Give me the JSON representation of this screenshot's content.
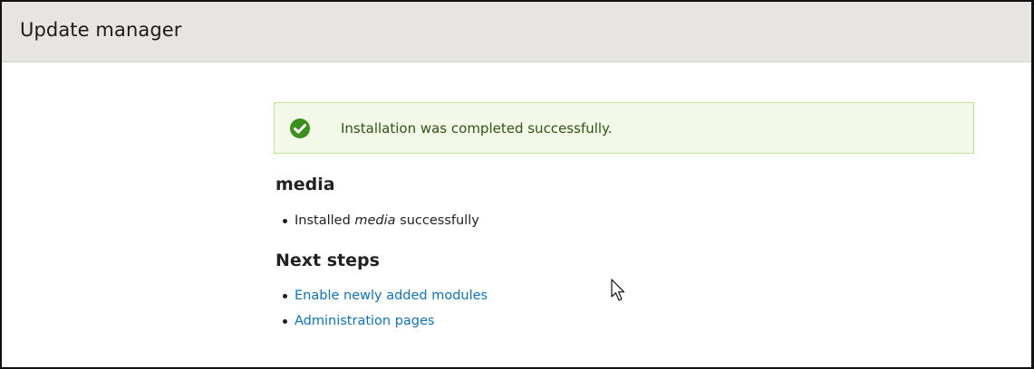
{
  "header": {
    "title": "Update manager"
  },
  "status": {
    "message": "Installation was completed successfully.",
    "icon": "check-circle-icon",
    "accent_color": "#3a8f1f",
    "background_color": "#f3f9e8",
    "border_color": "#c3e199"
  },
  "module_section": {
    "heading": "media",
    "items": [
      {
        "prefix": "Installed ",
        "module_name": "media",
        "suffix": " successfully"
      }
    ]
  },
  "next_steps": {
    "heading": "Next steps",
    "links": [
      {
        "label": "Enable newly added modules"
      },
      {
        "label": "Administration pages"
      }
    ]
  },
  "colors": {
    "link": "#0f73b8",
    "header_bg": "#e6e5e1"
  }
}
